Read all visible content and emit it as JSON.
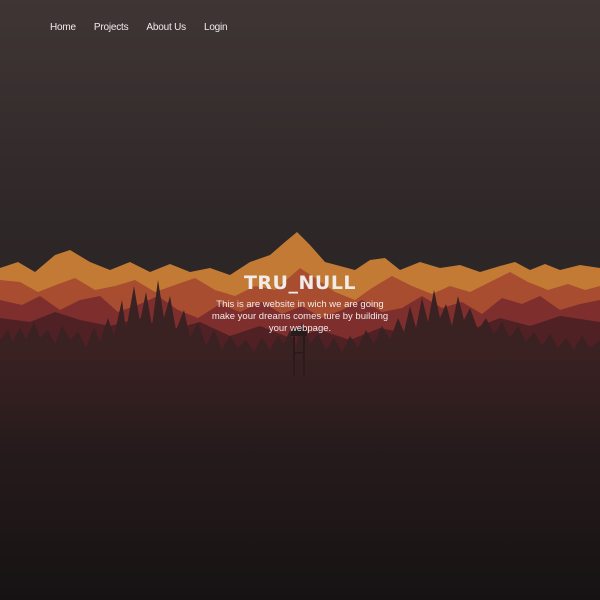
{
  "nav": {
    "items": [
      {
        "label": "Home"
      },
      {
        "label": "Projects"
      },
      {
        "label": "About Us"
      },
      {
        "label": "Login"
      }
    ]
  },
  "hero": {
    "title": "TRU_NULL",
    "subtitle": "This is are website in wich we are going make your dreams comes ture by building your webpage."
  },
  "colors": {
    "background_top": "#3f3535",
    "background_bottom": "#1a1415",
    "mountain_gold": "#c27a35",
    "mountain_orange": "#b0552f",
    "mountain_red": "#8a3530",
    "mountain_maroon": "#5c2528",
    "forest_dark": "#2e1d1e",
    "text": "#f1ebe9"
  }
}
